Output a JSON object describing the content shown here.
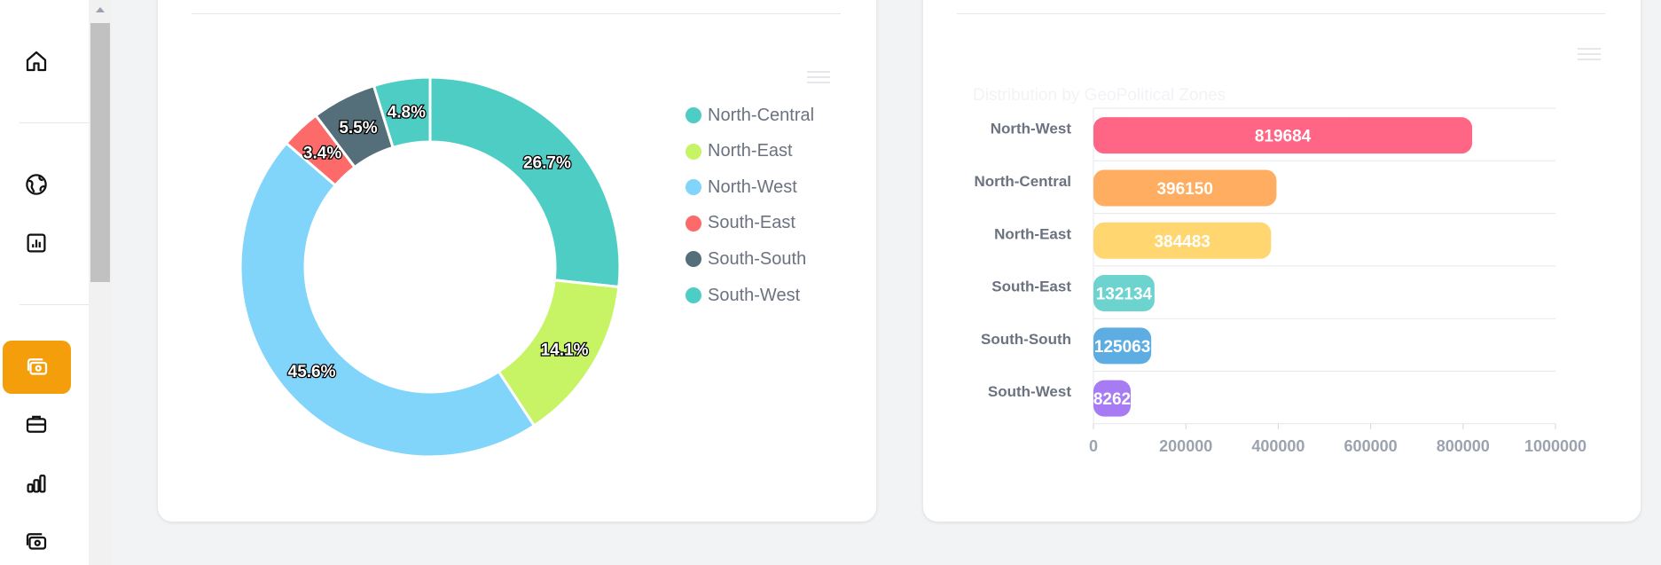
{
  "sidebar": {
    "icons": [
      {
        "name": "home-icon"
      },
      {
        "name": "globe-icon"
      },
      {
        "name": "report-chart-icon"
      },
      {
        "name": "cash-icon",
        "active": true
      },
      {
        "name": "briefcase-icon"
      },
      {
        "name": "bar-chart-icon"
      },
      {
        "name": "cash-icon-2"
      }
    ],
    "active_color": "#f59e0b"
  },
  "pie_chart": {
    "legend": [
      {
        "label": "North-Central",
        "color": "#4ecdc4"
      },
      {
        "label": "North-East",
        "color": "#c7f464"
      },
      {
        "label": "North-West",
        "color": "#81d4fa"
      },
      {
        "label": "South-East",
        "color": "#fd6a6a"
      },
      {
        "label": "South-South",
        "color": "#546e7a"
      },
      {
        "label": "South-West",
        "color": "#4ecdc4"
      }
    ]
  },
  "bar_chart": {
    "ghost_title": "Distribution by GeoPolitical Zones"
  },
  "chart_data": [
    {
      "type": "pie",
      "donut": true,
      "labels": [
        "North-Central",
        "North-East",
        "North-West",
        "South-East",
        "South-South",
        "South-West"
      ],
      "values": [
        26.7,
        14.1,
        45.6,
        3.4,
        5.5,
        4.8
      ],
      "data_labels": [
        "26.7%",
        "14.1%",
        "45.6%",
        "3.4%",
        "5.5%",
        "4.8%"
      ],
      "colors": [
        "#4ecdc4",
        "#c7f464",
        "#81d4fa",
        "#fd6a6a",
        "#546e7a",
        "#4ecdc4"
      ],
      "legend": "right"
    },
    {
      "type": "bar",
      "orientation": "horizontal",
      "title": "Distribution by GeoPolitical Zones",
      "categories": [
        "North-West",
        "North-Central",
        "North-East",
        "South-East",
        "South-South",
        "South-West"
      ],
      "values": [
        819684,
        396150,
        384483,
        132134,
        125063,
        8262
      ],
      "data_labels": [
        "819684",
        "396150",
        "384483",
        "132134",
        "125063",
        "8262"
      ],
      "colors": [
        "#ff6584",
        "#ffad60",
        "#ffd670",
        "#6dd3ce",
        "#5dade2",
        "#a77bf3"
      ],
      "xlim": [
        0,
        1000000
      ],
      "x_ticks": [
        "0",
        "200000",
        "400000",
        "600000",
        "800000",
        "1000000"
      ],
      "grid": true
    }
  ]
}
